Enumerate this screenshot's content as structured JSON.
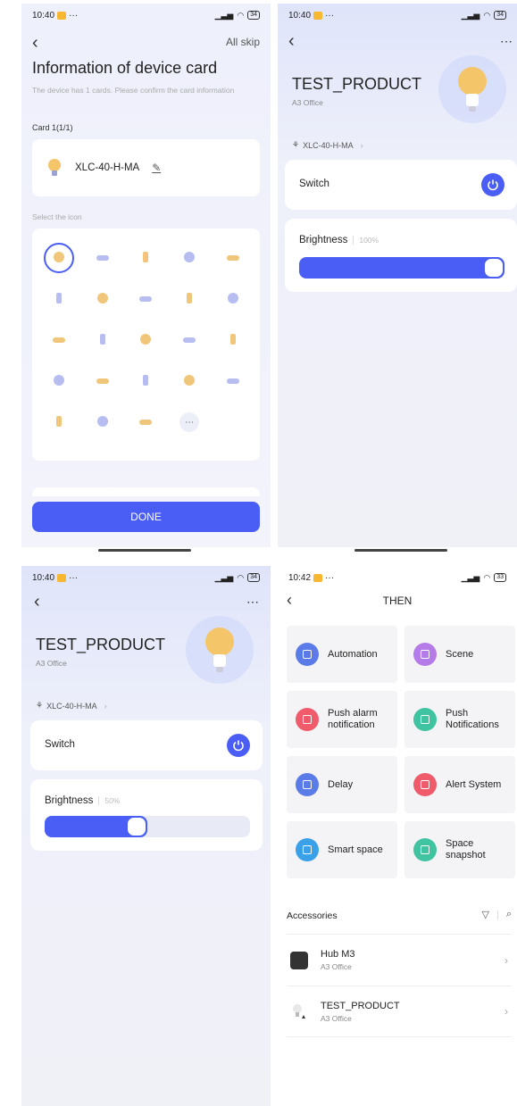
{
  "colors": {
    "accent": "#4a5ef5",
    "bulb_glow": "#f5c56a"
  },
  "status_bars": [
    {
      "time": "10:40",
      "dots": "···",
      "signal": "ᵊᵍᵅᵏᵊ",
      "battery": "34"
    },
    {
      "time": "10:40",
      "dots": "···",
      "signal": "ᵊᵍᵅᵏᵊ",
      "battery": "34"
    },
    {
      "time": "10:40",
      "dots": "···",
      "signal": "ᵊᵍᵅᵏᵊ",
      "battery": "34"
    },
    {
      "time": "10:42",
      "dots": "···",
      "signal": "ᵊᵍᵅᵏᵊ",
      "battery": "33"
    }
  ],
  "card_screen": {
    "skip_label": "All skip",
    "title": "Information of device card",
    "subtitle": "The device has 1 cards. Please confirm the card information",
    "card_label": "Card 1(1/1)",
    "card_name": "XLC-40-H-MA",
    "select_icon_label": "Select the icon",
    "icons": [
      "bulb-icon",
      "ceiling-lamp-icon",
      "flat-panel-icon",
      "pendant-icon",
      "chandelier-icon",
      "track-light-icon",
      "arc-lamp-icon",
      "table-lamp-icon",
      "desk-lamp-icon",
      "downlight-icon",
      "spotlight-icon",
      "ring-light-icon",
      "string-light-icon",
      "cluster-light-icon",
      "multi-spot-icon",
      "wall-bar-icon",
      "floor-lamp-icon",
      "standing-lamp-icon",
      "wall-lamp-icon",
      "batten-icon",
      "panel-lamp-icon",
      "strip-light-icon",
      "dome-pendant-icon",
      "more-icon"
    ],
    "done_label": "DONE"
  },
  "detail_100": {
    "title": "TEST_PRODUCT",
    "location": "A3 Office",
    "model": "XLC-40-H-MA",
    "switch_label": "Switch",
    "brightness_label": "Brightness",
    "brightness_text": "100%",
    "brightness_value": 1.0
  },
  "detail_50": {
    "title": "TEST_PRODUCT",
    "location": "A3 Office",
    "model": "XLC-40-H-MA",
    "switch_label": "Switch",
    "brightness_label": "Brightness",
    "brightness_text": "50%",
    "brightness_value": 0.5
  },
  "then_screen": {
    "title": "THEN",
    "tiles": [
      {
        "label": "Automation",
        "color": "#5b7be8",
        "icon": "automation-icon"
      },
      {
        "label": "Scene",
        "color": "#b57be8",
        "icon": "scene-icon"
      },
      {
        "label": "Push alarm notification",
        "color": "#ef5b6b",
        "icon": "alarm-icon"
      },
      {
        "label": "Push Notifications",
        "color": "#3fc3a0",
        "icon": "mail-icon"
      },
      {
        "label": "Delay",
        "color": "#5b7be8",
        "icon": "clock-icon"
      },
      {
        "label": "Alert System",
        "color": "#ef5b6b",
        "icon": "shield-icon"
      },
      {
        "label": "Smart space",
        "color": "#3aa0e8",
        "icon": "home-icon"
      },
      {
        "label": "Space snapshot",
        "color": "#3fc3a0",
        "icon": "camera-icon"
      }
    ],
    "accessories_label": "Accessories",
    "accessories": [
      {
        "name": "Hub M3",
        "location": "A3 Office"
      },
      {
        "name": "TEST_PRODUCT",
        "location": "A3 Office"
      }
    ]
  }
}
